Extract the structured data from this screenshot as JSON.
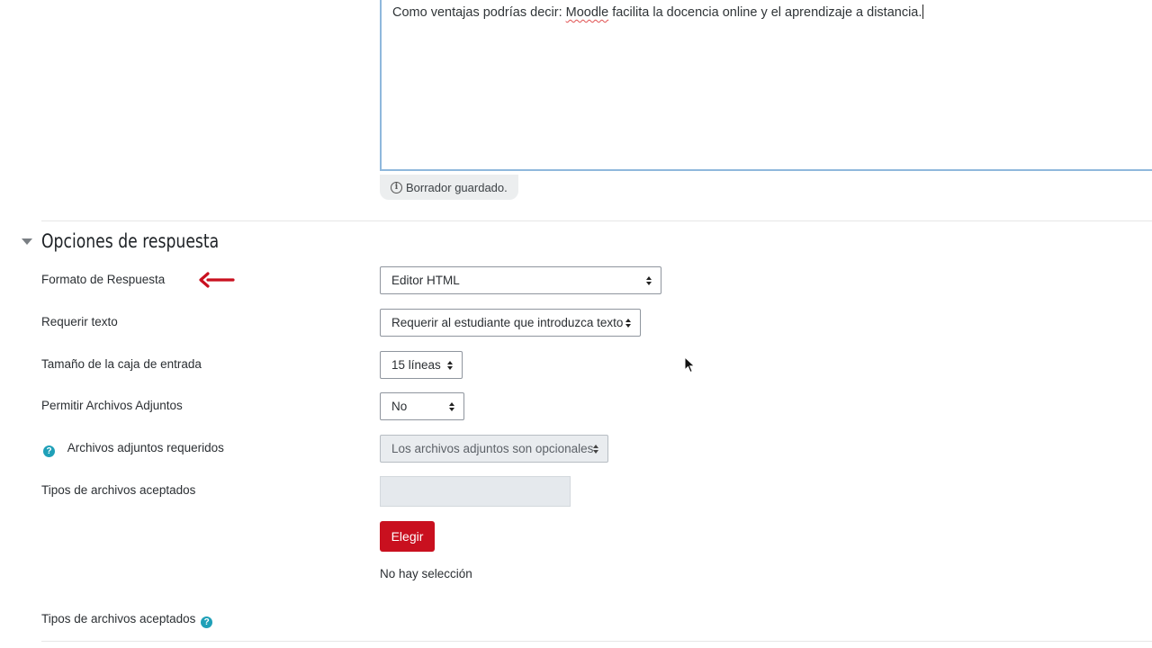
{
  "editor": {
    "text_before": "Como ventajas podrías decir: ",
    "text_misspelled": "Moodle",
    "text_after": " facilita la docencia online y el aprendizaje a distancia."
  },
  "draft_status": "Borrador guardado.",
  "section": {
    "title": "Opciones de respuesta"
  },
  "fields": {
    "response_format": {
      "label": "Formato de Respuesta",
      "value": "Editor HTML"
    },
    "require_text": {
      "label": "Requerir texto",
      "value": "Requerir al estudiante que introduzca texto"
    },
    "input_box_size": {
      "label": "Tamaño de la caja de entrada",
      "value": "15 líneas"
    },
    "allow_attachments": {
      "label": "Permitir Archivos Adjuntos",
      "value": "No"
    },
    "required_attachments": {
      "label": "Archivos adjuntos requeridos",
      "value": "Los archivos adjuntos son opcionales"
    },
    "accepted_filetypes": {
      "label": "Tipos de archivos aceptados"
    }
  },
  "choose_button": "Elegir",
  "no_selection": "No hay selección",
  "accepted_filetypes_label_2": "Tipos de archivos aceptados",
  "icons": {
    "help": "?",
    "info": "i"
  },
  "colors": {
    "accent_red": "#c9101f",
    "help_teal": "#1fa0b8",
    "editor_border": "#8fb8dc",
    "disabled_bg": "#e9ecef"
  }
}
